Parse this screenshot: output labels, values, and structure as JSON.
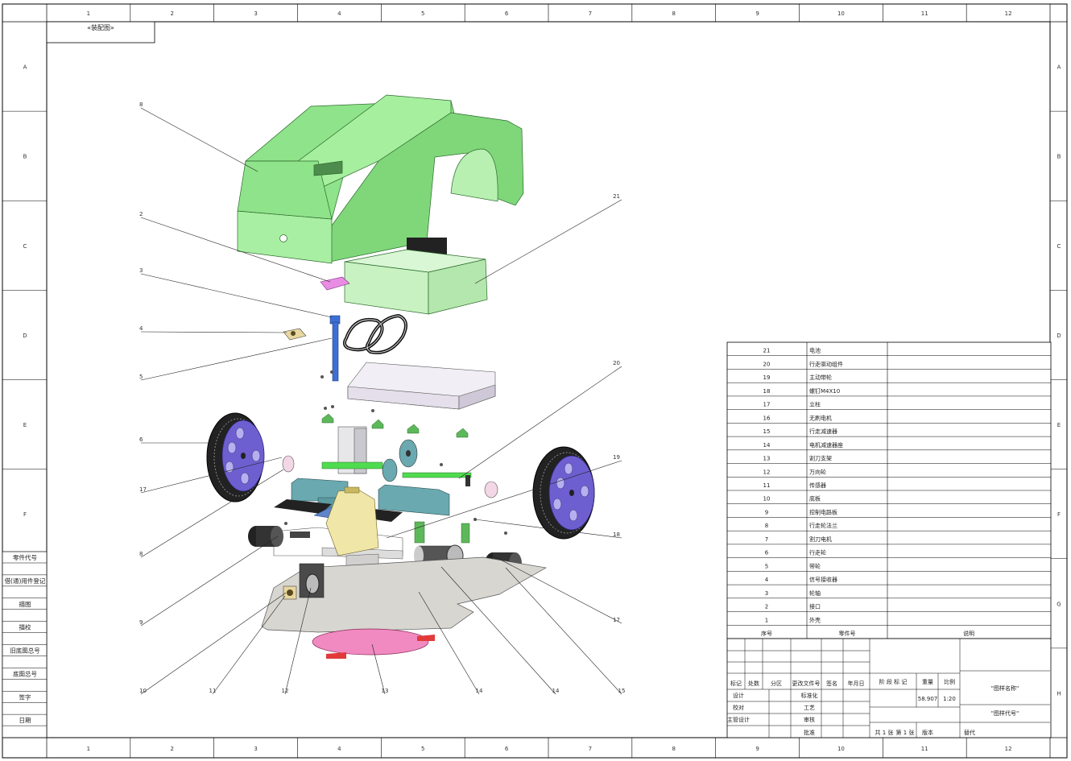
{
  "sheet_title": "«装配图»",
  "zone_columns": [
    "1",
    "2",
    "3",
    "4",
    "5",
    "6",
    "7",
    "8",
    "9",
    "10",
    "11",
    "12"
  ],
  "zone_rows": [
    "A",
    "B",
    "C",
    "D",
    "E",
    "F",
    "G",
    "H"
  ],
  "left_strip": [
    "零件代号",
    "借(通)用件登记",
    "描图",
    "描校",
    "旧底图总号",
    "底图总号",
    "签字",
    "日期"
  ],
  "callouts_left": [
    "8",
    "2",
    "3",
    "4",
    "5",
    "6",
    "17",
    "8",
    "9",
    "10",
    "11",
    "12"
  ],
  "callouts_right": [
    "21",
    "20",
    "19",
    "18",
    "17",
    "16",
    "15",
    "14",
    "13"
  ],
  "bom": {
    "rows": [
      {
        "no": "21",
        "name": "电池"
      },
      {
        "no": "20",
        "name": "行走驱动组件"
      },
      {
        "no": "19",
        "name": "主动带轮"
      },
      {
        "no": "18",
        "name": "螺钉M4X10"
      },
      {
        "no": "17",
        "name": "立柱"
      },
      {
        "no": "16",
        "name": "无刷电机"
      },
      {
        "no": "15",
        "name": "行走减速器"
      },
      {
        "no": "14",
        "name": "电机减速器座"
      },
      {
        "no": "13",
        "name": "割刀支架"
      },
      {
        "no": "12",
        "name": "万向轮"
      },
      {
        "no": "11",
        "name": "传感器"
      },
      {
        "no": "10",
        "name": "底板"
      },
      {
        "no": "9",
        "name": "控制电路板"
      },
      {
        "no": "8",
        "name": "行走轮法兰"
      },
      {
        "no": "7",
        "name": "割刀电机"
      },
      {
        "no": "6",
        "name": "行走轮"
      },
      {
        "no": "5",
        "name": "带轮"
      },
      {
        "no": "4",
        "name": "信号接收器"
      },
      {
        "no": "3",
        "name": "轮轴"
      },
      {
        "no": "2",
        "name": "接口"
      },
      {
        "no": "1",
        "name": "外壳"
      }
    ],
    "header": {
      "no": "序号",
      "name": "零件号",
      "desc": "说明"
    }
  },
  "title_block": {
    "rev_headers": [
      "标记",
      "处数",
      "分区",
      "更改文件号",
      "签名",
      "年月日"
    ],
    "roles_left": [
      "设计",
      "校对",
      "主管设计"
    ],
    "roles_right": [
      "标准化",
      "工艺",
      "审核",
      "批准"
    ],
    "stage_label": "阶 段 标 记",
    "weight_label": "重量",
    "scale_label": "比例",
    "weight_value": "58.907",
    "scale_value": "1:20",
    "sheet_total": "共 1 张",
    "sheet_no": "第 1 张",
    "version_label": "版本",
    "replace_label": "替代",
    "drawing_name": "\"图样名称\"",
    "drawing_code": "\"图样代号\""
  },
  "colors": {
    "shell": "#8fe38a",
    "shell_dark": "#6cc368",
    "battery": "#c8f2c2",
    "wheel_hub": "#6d5fd0",
    "wheel_tire": "#222222",
    "blue_shaft": "#3c6fd6",
    "base_plate": "#d8d6d0",
    "blade": "#f08ac0",
    "gearbox": "#6aa9b0",
    "connector": "#e98de4",
    "bracket_yellow": "#efe6a8"
  }
}
